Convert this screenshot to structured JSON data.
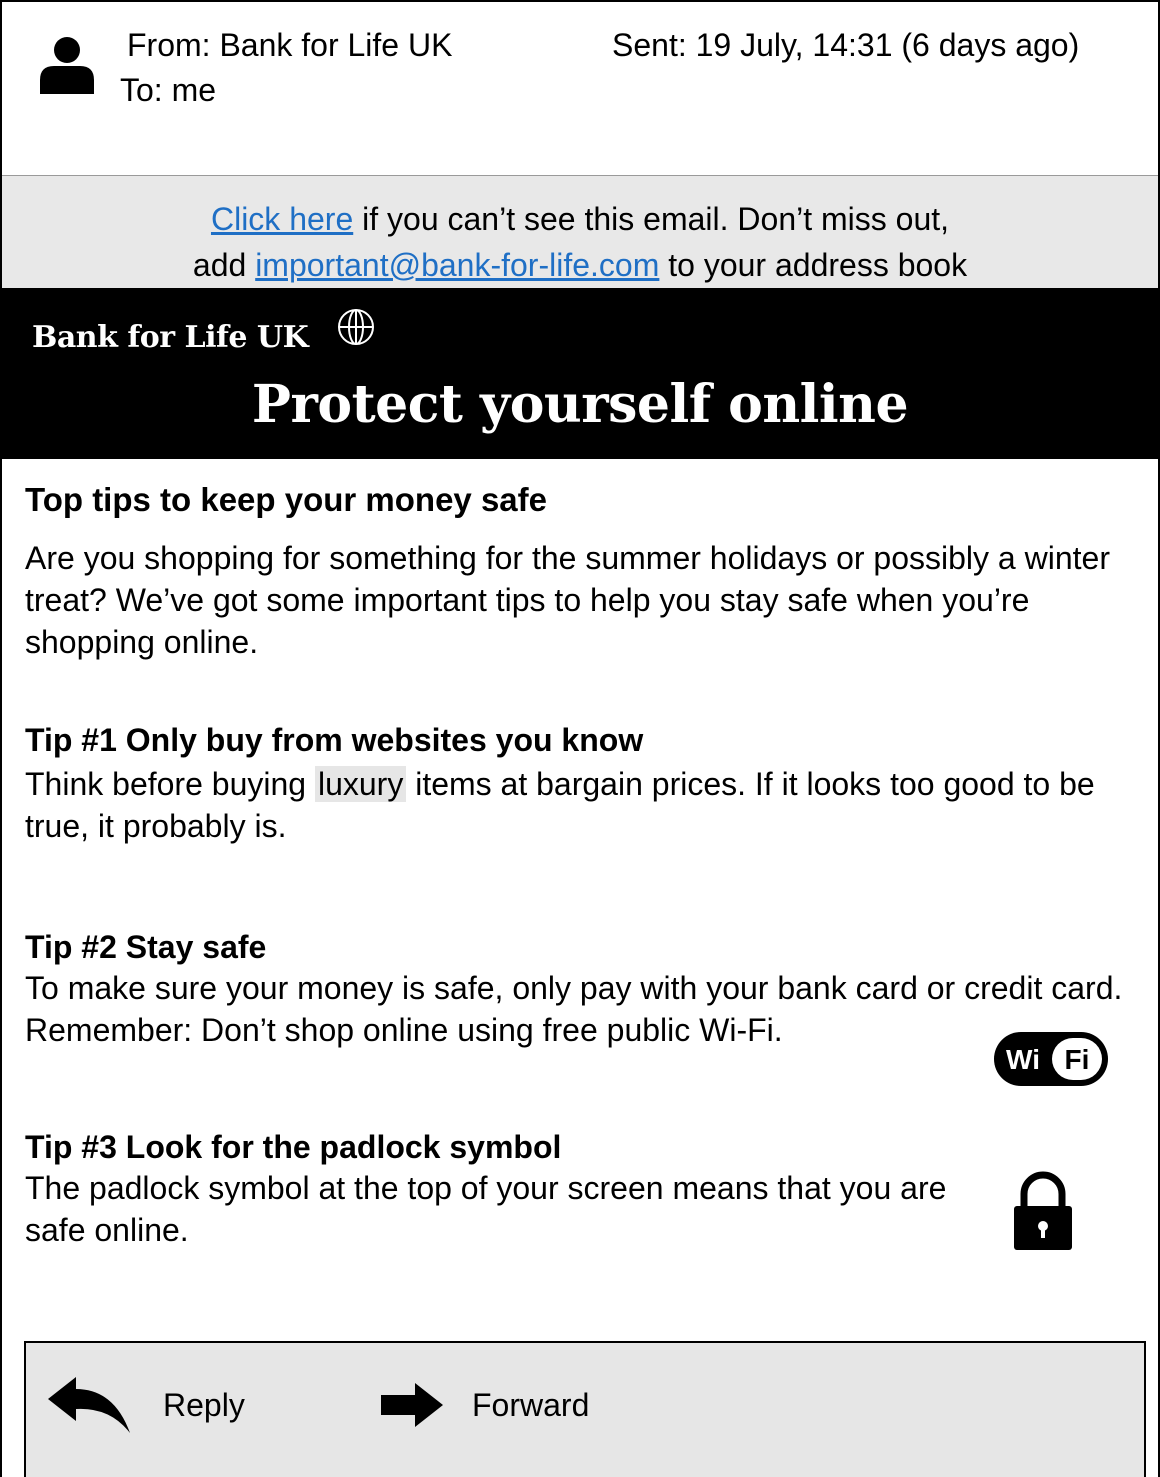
{
  "header": {
    "from": "From: Bank for Life UK",
    "to": "To: me",
    "sent": "Sent: 19 July, 14:31 (6 days ago)",
    "avatar_icon": "person-icon"
  },
  "notice": {
    "link1": "Click here",
    "text1": " if you can’t see this email. Don’t miss out,",
    "text2_prefix": "add ",
    "email_link": "important@bank-for-life.com",
    "text2_suffix": " to your address book",
    "link_color": "#1f6fc5"
  },
  "banner": {
    "brand": "Bank for Life UK",
    "brand_icon": "globe-icon",
    "title": "Protect yourself online"
  },
  "body": {
    "heading": "Top tips to keep your money safe",
    "intro": "Are you shopping for something for the summer holidays or possibly a winter treat? We’ve got some important tips to help you stay safe when you’re shopping online.",
    "tips": [
      {
        "title": "Tip #1 Only buy from websites you know",
        "text_before": "Think before buying ",
        "highlight": "luxury",
        "text_after": " items at bargain prices. If it looks too good to be true, it probably is."
      },
      {
        "title": "Tip #2 Stay safe",
        "text": "To make sure your money is safe, only pay with your bank card or credit card. Remember: Don’t shop online using free public Wi-Fi.",
        "icon": "wifi-icon",
        "icon_text_1": "Wi",
        "icon_text_2": "Fi"
      },
      {
        "title": "Tip #3 Look for the padlock symbol",
        "text": "The padlock symbol at the top of your screen means that you are safe online.",
        "icon": "padlock-icon"
      }
    ]
  },
  "actions": {
    "reply_label": "Reply",
    "reply_icon": "reply-arrow-icon",
    "forward_label": "Forward",
    "forward_icon": "forward-arrow-icon"
  }
}
